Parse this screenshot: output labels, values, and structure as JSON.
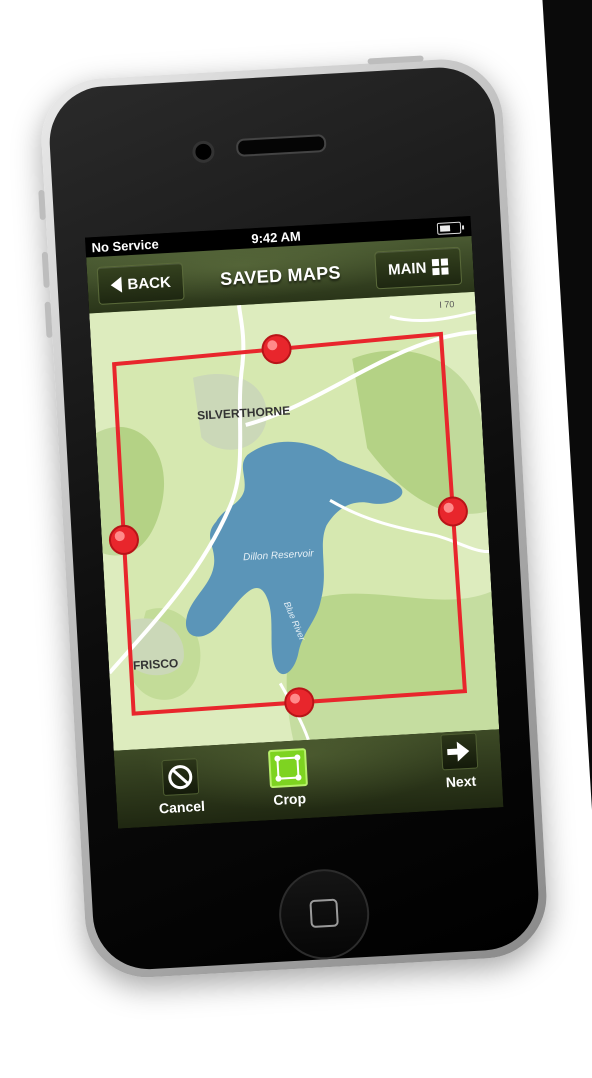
{
  "status_bar": {
    "carrier": "No Service",
    "time": "9:42 AM",
    "battery_icon": "battery-icon"
  },
  "nav": {
    "back_label": "BACK",
    "title": "SAVED MAPS",
    "main_label": "MAIN",
    "back_icon": "chevron-left-icon",
    "main_icon": "grid-icon"
  },
  "map": {
    "labels": {
      "town_north": "SILVERTHORNE",
      "town_south": "FRISCO",
      "lake": "Dillon Reservoir",
      "river": "Blue River",
      "highway": "I 70"
    },
    "colors": {
      "land": "#cfe3a8",
      "forest": "#a9c97a",
      "water": "#5b95b8",
      "crop_frame": "#e8262c"
    }
  },
  "toolbar": {
    "cancel_label": "Cancel",
    "crop_label": "Crop",
    "next_label": "Next",
    "cancel_icon": "prohibited-icon",
    "crop_icon": "crop-icon",
    "next_icon": "arrow-right-icon"
  }
}
